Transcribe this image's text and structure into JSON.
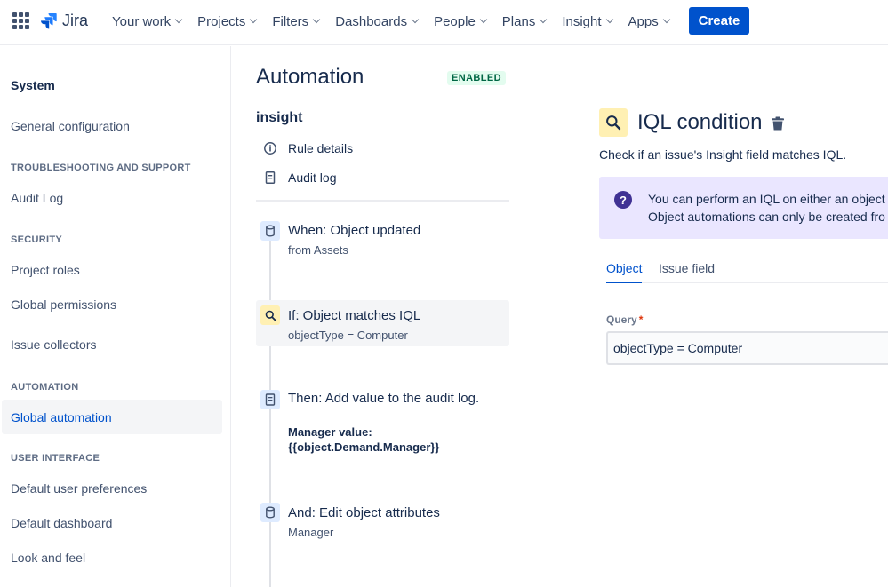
{
  "topnav": {
    "logo_text": "Jira",
    "items": [
      {
        "label": "Your work"
      },
      {
        "label": "Projects"
      },
      {
        "label": "Filters"
      },
      {
        "label": "Dashboards"
      },
      {
        "label": "People"
      },
      {
        "label": "Plans"
      },
      {
        "label": "Insight"
      },
      {
        "label": "Apps"
      }
    ],
    "create_label": "Create"
  },
  "sidebar": {
    "title": "System",
    "general_config": "General configuration",
    "sections": {
      "troubleshooting": "TROUBLESHOOTING AND SUPPORT",
      "security": "SECURITY",
      "automation": "AUTOMATION",
      "user_interface": "USER INTERFACE"
    },
    "items": {
      "audit_log": "Audit Log",
      "project_roles": "Project roles",
      "global_permissions": "Global permissions",
      "issue_collectors": "Issue collectors",
      "global_automation": "Global automation",
      "default_user_preferences": "Default user preferences",
      "default_dashboard": "Default dashboard",
      "look_and_feel": "Look and feel"
    }
  },
  "rule": {
    "page_title": "Automation",
    "status": "ENABLED",
    "name": "insight",
    "rule_details": "Rule details",
    "audit_log": "Audit log",
    "steps": [
      {
        "head": "When: Object updated",
        "sub": "from Assets"
      },
      {
        "head": "If: Object matches IQL",
        "sub": "objectType = Computer"
      },
      {
        "head": "Then: Add value to the audit log.",
        "sub": "Manager value: {{object.Demand.Manager}}"
      },
      {
        "head": "And: Edit object attributes",
        "sub": "Manager"
      }
    ]
  },
  "panel": {
    "title": "IQL condition",
    "description": "Check if an issue's Insight field matches IQL.",
    "info_line1": "You can perform an IQL on either an object",
    "info_line2": "Object automations can only be created fro",
    "tabs": [
      {
        "label": "Object"
      },
      {
        "label": "Issue field"
      }
    ],
    "query_label": "Query",
    "query_required": "*",
    "query_value": "objectType = Computer"
  },
  "colors": {
    "brand": "#0052cc",
    "enabled_text": "#006644",
    "enabled_bg": "#e3fcef",
    "info_bg": "#eae6ff",
    "condition_badge": "#fff0b3",
    "action_badge": "#deebff"
  }
}
